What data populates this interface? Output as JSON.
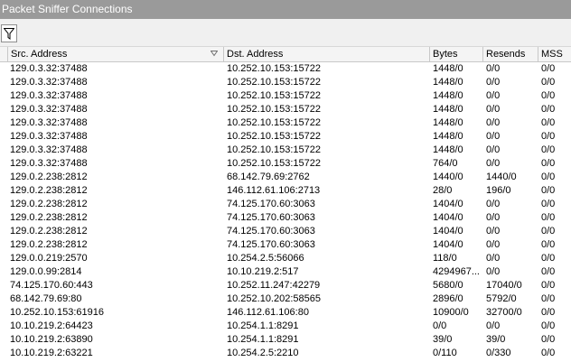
{
  "window": {
    "title": "Packet Sniffer Connections"
  },
  "toolbar": {
    "filter_icon": "filter-icon"
  },
  "columns": [
    {
      "label": "Src. Address",
      "sorted": true
    },
    {
      "label": "Dst. Address"
    },
    {
      "label": "Bytes"
    },
    {
      "label": "Resends"
    },
    {
      "label": "MSS"
    }
  ],
  "rows": [
    [
      "129.0.3.32:37488",
      "10.252.10.153:15722",
      "1448/0",
      "0/0",
      "0/0"
    ],
    [
      "129.0.3.32:37488",
      "10.252.10.153:15722",
      "1448/0",
      "0/0",
      "0/0"
    ],
    [
      "129.0.3.32:37488",
      "10.252.10.153:15722",
      "1448/0",
      "0/0",
      "0/0"
    ],
    [
      "129.0.3.32:37488",
      "10.252.10.153:15722",
      "1448/0",
      "0/0",
      "0/0"
    ],
    [
      "129.0.3.32:37488",
      "10.252.10.153:15722",
      "1448/0",
      "0/0",
      "0/0"
    ],
    [
      "129.0.3.32:37488",
      "10.252.10.153:15722",
      "1448/0",
      "0/0",
      "0/0"
    ],
    [
      "129.0.3.32:37488",
      "10.252.10.153:15722",
      "1448/0",
      "0/0",
      "0/0"
    ],
    [
      "129.0.3.32:37488",
      "10.252.10.153:15722",
      "764/0",
      "0/0",
      "0/0"
    ],
    [
      "129.0.2.238:2812",
      "68.142.79.69:2762",
      "1440/0",
      "1440/0",
      "0/0"
    ],
    [
      "129.0.2.238:2812",
      "146.112.61.106:2713",
      "28/0",
      "196/0",
      "0/0"
    ],
    [
      "129.0.2.238:2812",
      "74.125.170.60:3063",
      "1404/0",
      "0/0",
      "0/0"
    ],
    [
      "129.0.2.238:2812",
      "74.125.170.60:3063",
      "1404/0",
      "0/0",
      "0/0"
    ],
    [
      "129.0.2.238:2812",
      "74.125.170.60:3063",
      "1404/0",
      "0/0",
      "0/0"
    ],
    [
      "129.0.2.238:2812",
      "74.125.170.60:3063",
      "1404/0",
      "0/0",
      "0/0"
    ],
    [
      "129.0.0.219:2570",
      "10.254.2.5:56066",
      "118/0",
      "0/0",
      "0/0"
    ],
    [
      "129.0.0.99:2814",
      "10.10.219.2:517",
      "4294967...",
      "0/0",
      "0/0"
    ],
    [
      "74.125.170.60:443",
      "10.252.11.247:42279",
      "5680/0",
      "17040/0",
      "0/0"
    ],
    [
      "68.142.79.69:80",
      "10.252.10.202:58565",
      "2896/0",
      "5792/0",
      "0/0"
    ],
    [
      "10.252.10.153:61916",
      "146.112.61.106:80",
      "10900/0",
      "32700/0",
      "0/0"
    ],
    [
      "10.10.219.2:64423",
      "10.254.1.1:8291",
      "0/0",
      "0/0",
      "0/0"
    ],
    [
      "10.10.219.2:63890",
      "10.254.1.1:8291",
      "39/0",
      "39/0",
      "0/0"
    ],
    [
      "10.10.219.2:63221",
      "10.254.2.5:2210",
      "0/110",
      "0/330",
      "0/0"
    ]
  ]
}
